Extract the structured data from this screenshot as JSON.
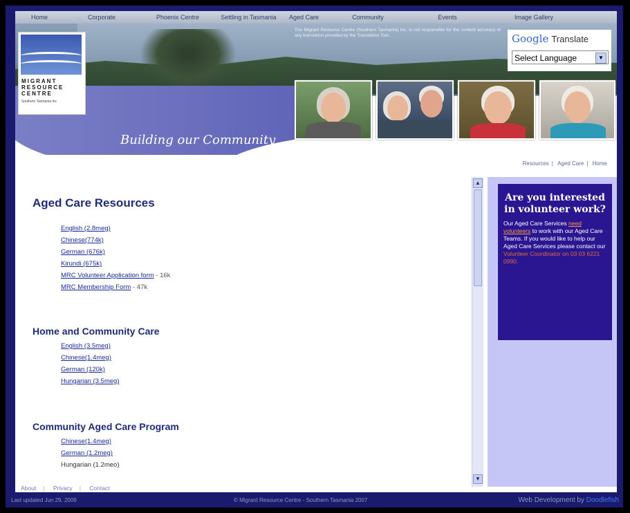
{
  "nav": [
    "Home",
    "Corporate",
    "Phoenix Centre",
    "Settling in Tasmania",
    "Aged Care",
    "Community",
    "Events",
    "Image Gallery"
  ],
  "banner": {
    "logo_lines": [
      "MIGRANT",
      "RESOURCE",
      "CENTRE"
    ],
    "logo_sub": "Southern Tasmania Inc",
    "tagline": "Building our Community",
    "disclaimer": "The Migrant Resource Centre (Southern Tasmania) Inc. is not responsible for the content accuracy of any translation provided by the Translation Tool."
  },
  "translate": {
    "google": "Google",
    "translate_word": "Translate",
    "select_label": "Select Language"
  },
  "breadcrumb": [
    "Resources",
    "Aged Care",
    "Home"
  ],
  "main": {
    "aged_title": "Aged Care Resources",
    "aged_links": [
      {
        "label": "English (2.8meg)",
        "note": ""
      },
      {
        "label": "Chinese(774k)",
        "note": ""
      },
      {
        "label": "German (676k)",
        "note": ""
      },
      {
        "label": "Kirundi (675k)",
        "note": ""
      },
      {
        "label": "MRC Volunteer Application form",
        "note": " - 16k"
      },
      {
        "label": "MRC Membership Form",
        "note": " - 47k"
      }
    ],
    "home_title": "Home and Community Care",
    "home_links": [
      "English (3.5meg)",
      "Chinese(1.4meg)",
      "German (120k)",
      "Hungarian (3.5meg)"
    ],
    "cacp_title": "Community Aged Care Program",
    "cacp_links": [
      "Chinese(1.4meg)",
      "German (1.2meg)",
      "Hungarian (1.2meo)"
    ]
  },
  "volunteer": {
    "heading": "Are you interested in volunteer work?",
    "text1": "Our Aged Care Services",
    "link": "need volunteers",
    "text2": "to work with our Aged Care Teams. If you would like to help our Aged Care Services please contact our",
    "highlight": "Volunteer Coordinator on 03 03 6221 0990."
  },
  "footer_links": [
    "About",
    "Privacy",
    "Contact"
  ],
  "bottom": {
    "updated": "Last updated Jun 29, 2009",
    "copyright": "© Migrant Resource Centre - Southern Tasmania 2007",
    "dev_prefix": "Web Development by ",
    "dev_name": "Doodlefish"
  }
}
